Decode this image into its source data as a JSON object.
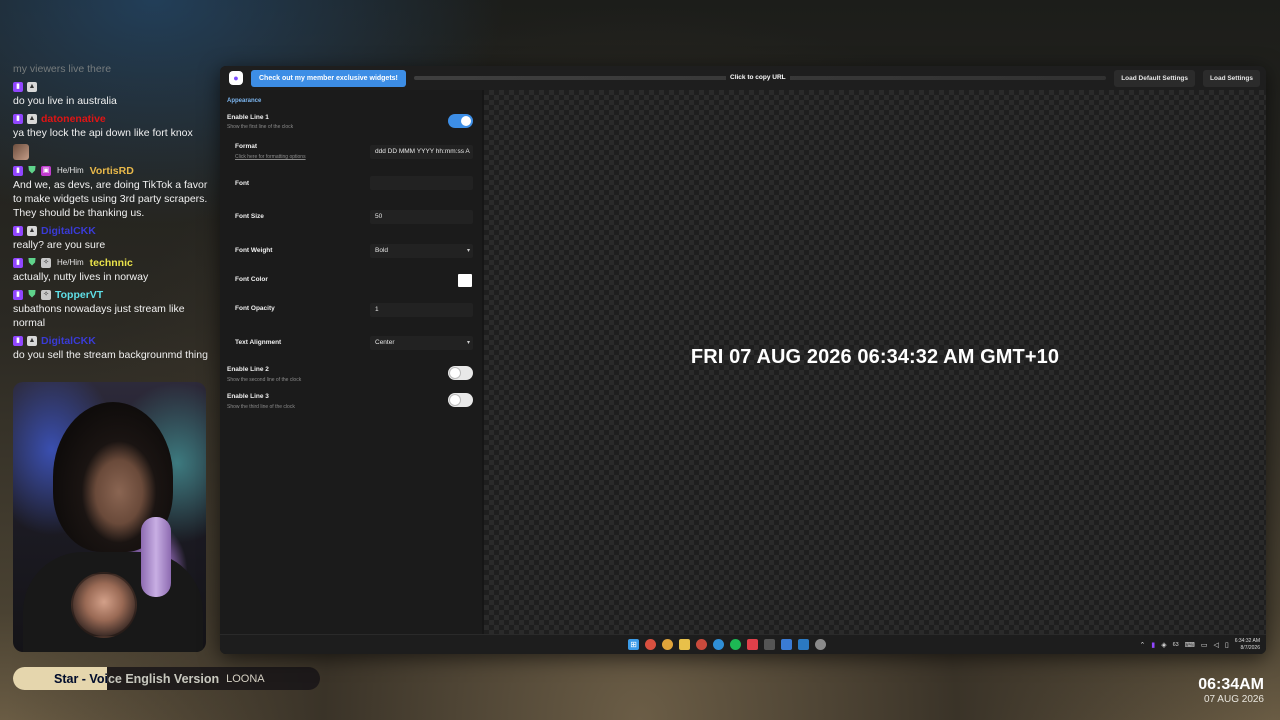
{
  "chat": {
    "fade_line": "my viewers live there",
    "messages": [
      {
        "user": "",
        "pronouns": "",
        "color": "#4a4bd9",
        "text": "do you live in australia",
        "badges": [
          "twitch",
          "vip"
        ]
      },
      {
        "user": "datonenative",
        "pronouns": "",
        "color": "#e01414",
        "text": "ya they lock the api down like fort knox",
        "badges": [
          "twitch",
          "vip"
        ]
      },
      {
        "user": "VortisRD",
        "pronouns": "He/Him",
        "color": "#e8b84a",
        "text": "And we, as devs, are doing TikTok a favor to make widgets using 3rd party scrapers. They should be thanking us.",
        "badges": [
          "twitch",
          "shield",
          "gift"
        ]
      },
      {
        "user": "DigitalCKK",
        "pronouns": "",
        "color": "#3a3bd6",
        "text": "really? are you sure",
        "badges": [
          "twitch",
          "vip"
        ]
      },
      {
        "user": "technnic",
        "pronouns": "He/Him",
        "color": "#e9e24a",
        "text": "actually, nutty lives in norway",
        "badges": [
          "twitch",
          "shield",
          "sub"
        ]
      },
      {
        "user": "TopperVT",
        "pronouns": "",
        "color": "#5fe0e8",
        "text": "subathons nowadays just stream like normal",
        "badges": [
          "twitch",
          "shield",
          "sub"
        ]
      },
      {
        "user": "DigitalCKK",
        "pronouns": "",
        "color": "#3a3bd6",
        "text": "do you sell the stream backgrounmd thing",
        "badges": [
          "twitch",
          "vip"
        ]
      }
    ]
  },
  "now_playing": {
    "song": "Star - Voice English Version",
    "artist": "LOONA",
    "progress": 0.306
  },
  "corner_clock": {
    "time": "06:34AM",
    "date": "07 AUG 2026"
  },
  "app": {
    "promo_button": "Check out my member exclusive widgets!",
    "copy_url": "Click to copy URL",
    "load_default": "Load Default Settings",
    "load_settings": "Load Settings",
    "section": "Appearance",
    "line1": {
      "label": "Enable Line 1",
      "sub": "Show the first line of the clock",
      "on": true
    },
    "format": {
      "label": "Format",
      "link": "Click here for formatting options",
      "value": "ddd DD MMM YYYY hh:mm:ss A"
    },
    "font": {
      "label": "Font",
      "value": ""
    },
    "font_size": {
      "label": "Font Size",
      "value": "50"
    },
    "font_weight": {
      "label": "Font Weight",
      "value": "Bold"
    },
    "font_color": {
      "label": "Font Color",
      "value": "#ffffff"
    },
    "font_opacity": {
      "label": "Font Opacity",
      "value": "1"
    },
    "text_alignment": {
      "label": "Text Alignment",
      "value": "Center"
    },
    "line2": {
      "label": "Enable Line 2",
      "sub": "Show the second line of the clock",
      "on": false
    },
    "line3": {
      "label": "Enable Line 3",
      "sub": "Show the third line of the clock",
      "on": false
    },
    "preview_text": "FRI 07 AUG 2026 06:34:32 AM GMT+10"
  },
  "taskbar": {
    "icons": [
      "windows-icon",
      "chrome-icon",
      "chrome-icon",
      "folder-icon",
      "chrome-icon",
      "edge-icon",
      "spotify-icon",
      "media-icon",
      "settings-icon",
      "app-icon",
      "vscode-icon",
      "gear-icon"
    ],
    "tray_num": "63",
    "time": "6:34:32 AM",
    "date": "8/7/2026"
  },
  "colors": {
    "accent": "#3d8ee6",
    "twitch": "#9146ff"
  }
}
